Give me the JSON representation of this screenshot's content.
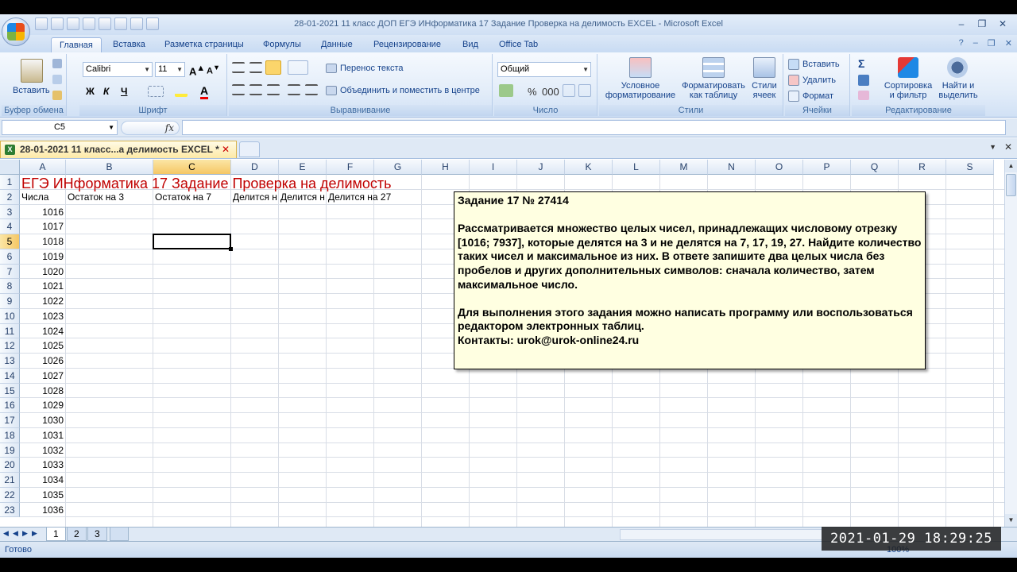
{
  "window": {
    "title": "28-01-2021 11 класс ДОП ЕГЭ ИНформатика 17 Задание Проверка на делимость  EXCEL - Microsoft Excel"
  },
  "ribbon_tabs": [
    "Главная",
    "Вставка",
    "Разметка страницы",
    "Формулы",
    "Данные",
    "Рецензирование",
    "Вид",
    "Office Tab"
  ],
  "ribbon": {
    "clipboard": {
      "paste_label": "Вставить",
      "group_label": "Буфер обмена"
    },
    "font": {
      "font_name": "Calibri",
      "font_size": "11",
      "bold": "Ж",
      "italic": "К",
      "underline": "Ч",
      "group_label": "Шрифт"
    },
    "alignment": {
      "wrap_text": "Перенос текста",
      "merge_center": "Объединить и поместить в центре",
      "group_label": "Выравнивание"
    },
    "number": {
      "format": "Общий",
      "group_label": "Число"
    },
    "styles": {
      "conditional": "Условное форматирование",
      "format_table": "Форматировать как таблицу",
      "cell_styles": "Стили ячеек",
      "group_label": "Стили"
    },
    "cells": {
      "insert": "Вставить",
      "delete": "Удалить",
      "format": "Формат",
      "group_label": "Ячейки"
    },
    "editing": {
      "sort_filter": "Сортировка и фильтр",
      "find_select": "Найти и выделить",
      "group_label": "Редактирование"
    }
  },
  "formula_bar": {
    "name_box": "C5",
    "fx": "fx",
    "value": ""
  },
  "doc_tab": {
    "label": "28-01-2021 11 класс...а делимость  EXCEL *"
  },
  "columns": [
    "A",
    "B",
    "C",
    "D",
    "E",
    "F",
    "G",
    "H",
    "I",
    "J",
    "K",
    "L",
    "M",
    "N",
    "O",
    "P",
    "Q",
    "R",
    "S"
  ],
  "rows": [
    "1",
    "2",
    "3",
    "4",
    "5",
    "6",
    "7",
    "8",
    "9",
    "10",
    "11",
    "12",
    "13",
    "14",
    "15",
    "16",
    "17",
    "18",
    "19",
    "20",
    "21",
    "22",
    "23"
  ],
  "sheet": {
    "title": "ЕГЭ ИНформатика 17 Задание Проверка на делимость",
    "headers": [
      "Числа",
      "Остаток на 3",
      "Остаток на 7",
      "Делится н",
      "Делится н",
      "Делится на 27"
    ],
    "numbers": [
      "1016",
      "1017",
      "1018",
      "1019",
      "1020",
      "1021",
      "1022",
      "1023",
      "1024",
      "1025",
      "1026",
      "1027",
      "1028",
      "1029",
      "1030",
      "1031",
      "1032",
      "1033",
      "1034",
      "1035",
      "1036"
    ]
  },
  "note": {
    "heading": "Задание 17 № 27414",
    "para1": "Рассматривается множество целых чисел, принадлежащих числовому отрезку [1016; 7937], которые делятся на 3 и не делятся на 7, 17, 19, 27. Найдите количество таких чисел и максимальное из них. В ответе запишите два целых числа без пробелов и других дополнительных символов: сначала количество, затем максимальное число.",
    "para2": "Для выполнения этого задания можно написать программу или воспользоваться редактором электронных таблиц.",
    "contacts": "Контакты: urok@urok-online24.ru"
  },
  "sheet_tabs": [
    "1",
    "2",
    "3"
  ],
  "status": {
    "ready": "Готово",
    "zoom": "100%"
  },
  "timestamp": "2021-01-29  18:29:25"
}
